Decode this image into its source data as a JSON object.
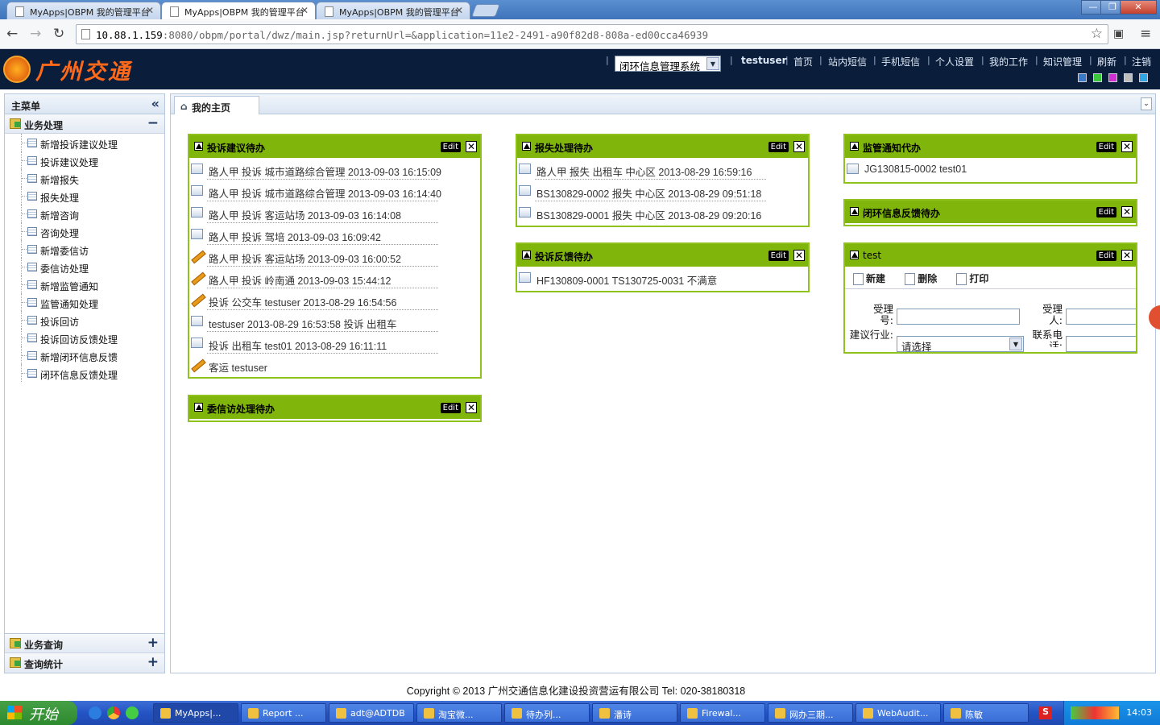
{
  "browser": {
    "tabs": [
      {
        "title": "MyApps|OBPM 我的管理平台"
      },
      {
        "title": "MyApps|OBPM 我的管理平台"
      },
      {
        "title": "MyApps|OBPM 我的管理平台"
      }
    ],
    "url_host": "10.88.1.159",
    "url_rest": ":8080/obpm/portal/dwz/main.jsp?returnUrl=&application=11e2-2491-a90f82d8-808a-ed00cca46939"
  },
  "header": {
    "logo_text": "广州交通",
    "system_select": "闭环信息管理系统",
    "username": "testuser",
    "links": [
      "首页",
      "站内短信",
      "手机短信",
      "个人设置",
      "我的工作",
      "知识管理",
      "刷新",
      "注销"
    ],
    "theme_colors": [
      "#3a78c8",
      "#3bc63b",
      "#d22fd2",
      "#bdbdbd",
      "#2fa7e6"
    ]
  },
  "sidebar": {
    "title": "主菜单",
    "sections": [
      {
        "label": "业务处理",
        "toggle": "−",
        "items": [
          "新增投诉建议处理",
          "投诉建议处理",
          "新增报失",
          "报失处理",
          "新增咨询",
          "咨询处理",
          "新增委信访",
          "委信访处理",
          "新增监管通知",
          "监管通知处理",
          "投诉回访",
          "投诉回访反馈处理",
          "新增闭环信息反馈",
          "闭环信息反馈处理"
        ]
      },
      {
        "label": "业务查询",
        "toggle": "+"
      },
      {
        "label": "查询统计",
        "toggle": "+"
      }
    ]
  },
  "main": {
    "tab_label": "我的主页",
    "edit_label": "Edit",
    "portlets": {
      "complaint": {
        "title": "投诉建议待办",
        "rows": [
          "路人甲 投诉 城市道路综合管理 2013-09-03 16:15:09",
          "路人甲 投诉 城市道路综合管理 2013-09-03 16:14:40",
          "路人甲 投诉 客运站场 2013-09-03 16:14:08",
          "路人甲 投诉 驾培 2013-09-03 16:09:42",
          "路人甲 投诉 客运站场 2013-09-03 16:00:52",
          "路人甲 投诉 岭南通 2013-09-03 15:44:12",
          "投诉 公交车 testuser 2013-08-29 16:54:56",
          "testuser 2013-08-29 16:53:58 投诉 出租车",
          "投诉 出租车 test01 2013-08-29 16:11:11",
          " 客运 testuser"
        ]
      },
      "petition": {
        "title": "委信访处理待办"
      },
      "lost": {
        "title": "报失处理待办",
        "rows": [
          "路人甲 报失 出租车 中心区 2013-08-29 16:59:16",
          "BS130829-0002 报失 中心区 2013-08-29 09:51:18",
          "BS130829-0001 报失 中心区 2013-08-29 09:20:16"
        ]
      },
      "feedback": {
        "title": "投诉反馈待办",
        "rows": [
          "HF130809-0001 TS130725-0031 不满意"
        ]
      },
      "supervise": {
        "title": "监管通知代办",
        "rows": [
          "JG130815-0002 test01"
        ]
      },
      "closedloop": {
        "title": "闭环信息反馈待办"
      },
      "test": {
        "title": "test",
        "toolbar": [
          "新建",
          "删除",
          "打印"
        ],
        "label_accept_no": "受理号:",
        "label_acceptor": "受理人:",
        "label_industry": "建议行业:",
        "industry_value": "请选择",
        "label_phone": "联系电话:"
      }
    }
  },
  "footer": {
    "copyright": "Copyright © 2013 广州交通信息化建设投资营运有限公司 Tel: 020-38180318"
  },
  "taskbar": {
    "start": "开始",
    "tasks": [
      "MyApps|...",
      "Report ...",
      "adt@ADTDB",
      "淘宝微...",
      "待办列...",
      "潘诗",
      "Firewal...",
      "网办三期...",
      "WebAudit...",
      "陈敏"
    ],
    "clock": "14:03"
  }
}
